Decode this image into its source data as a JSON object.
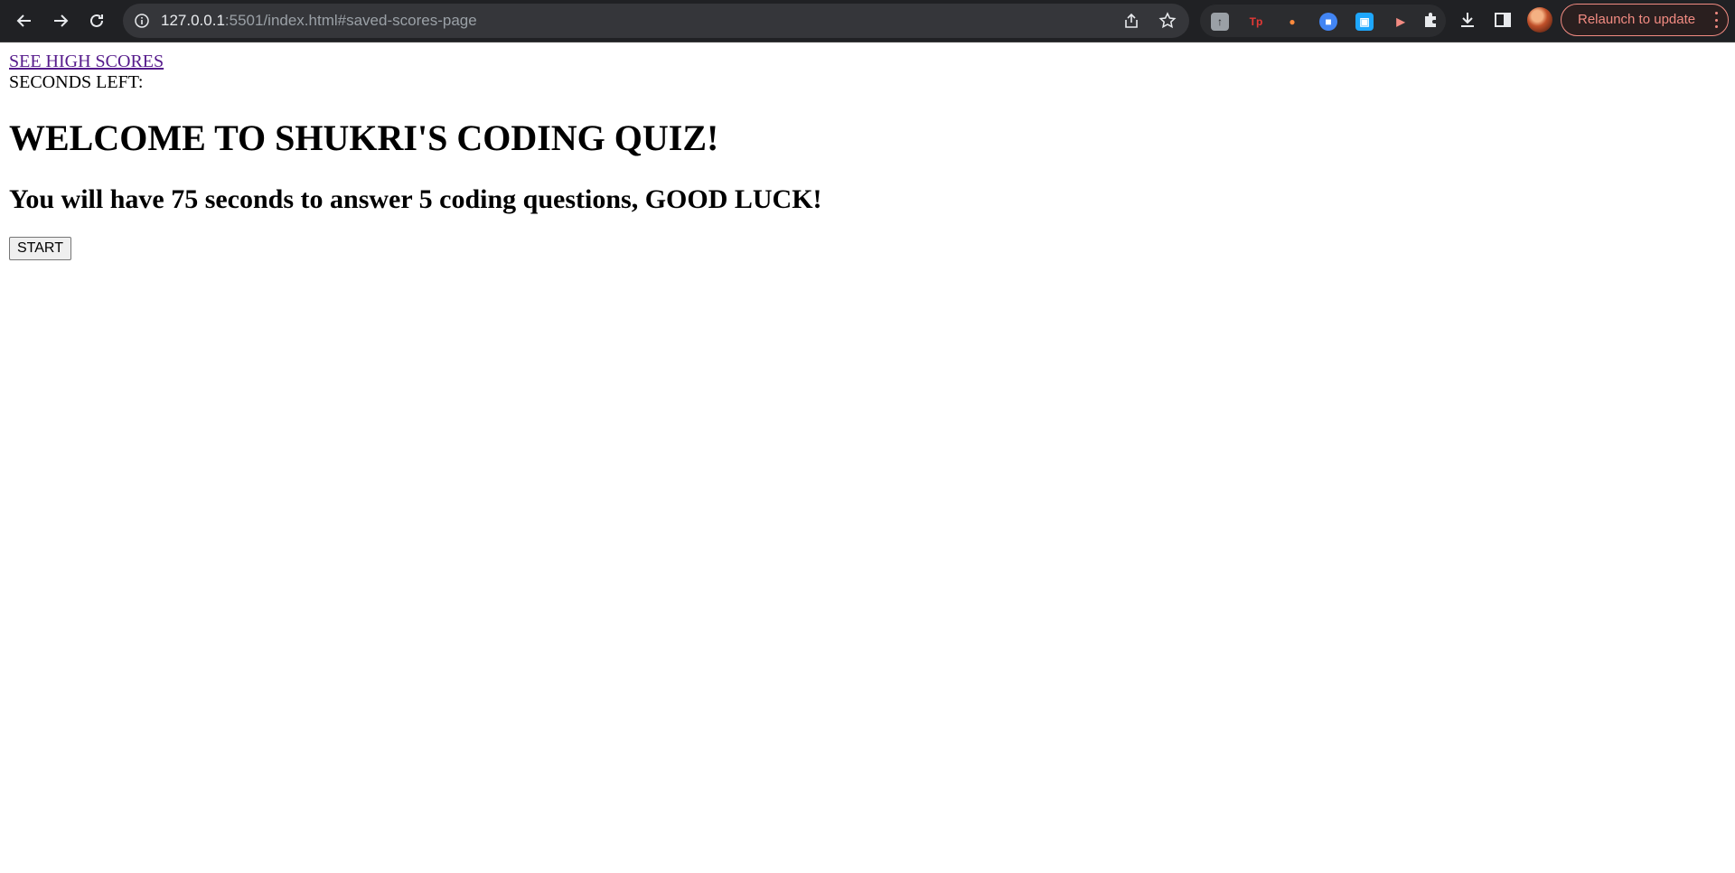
{
  "browser": {
    "url_host": "127.0.0.1",
    "url_rest": ":5501/index.html#saved-scores-page",
    "relaunch_label": "Relaunch to update",
    "extensions": [
      {
        "name": "ext-1",
        "glyph": "↑",
        "color": "#9aa0a6"
      },
      {
        "name": "ext-tp",
        "glyph": "Tp",
        "color": "#e53935"
      },
      {
        "name": "ext-3",
        "glyph": "●",
        "color": "#ff8a3d"
      },
      {
        "name": "ext-docs",
        "glyph": "■",
        "color": "#4285f4"
      },
      {
        "name": "ext-5",
        "glyph": "▣",
        "color": "#1ea7fd"
      },
      {
        "name": "ext-6",
        "glyph": "▶",
        "color": "#f28b82"
      }
    ]
  },
  "page": {
    "high_scores_link": "SEE HIGH SCORES",
    "seconds_left_label": "SECONDS LEFT:",
    "title": "WELCOME TO SHUKRI'S CODING QUIZ!",
    "subtitle": "You will have 75 seconds to answer 5 coding questions, GOOD LUCK!",
    "start_label": "START"
  }
}
